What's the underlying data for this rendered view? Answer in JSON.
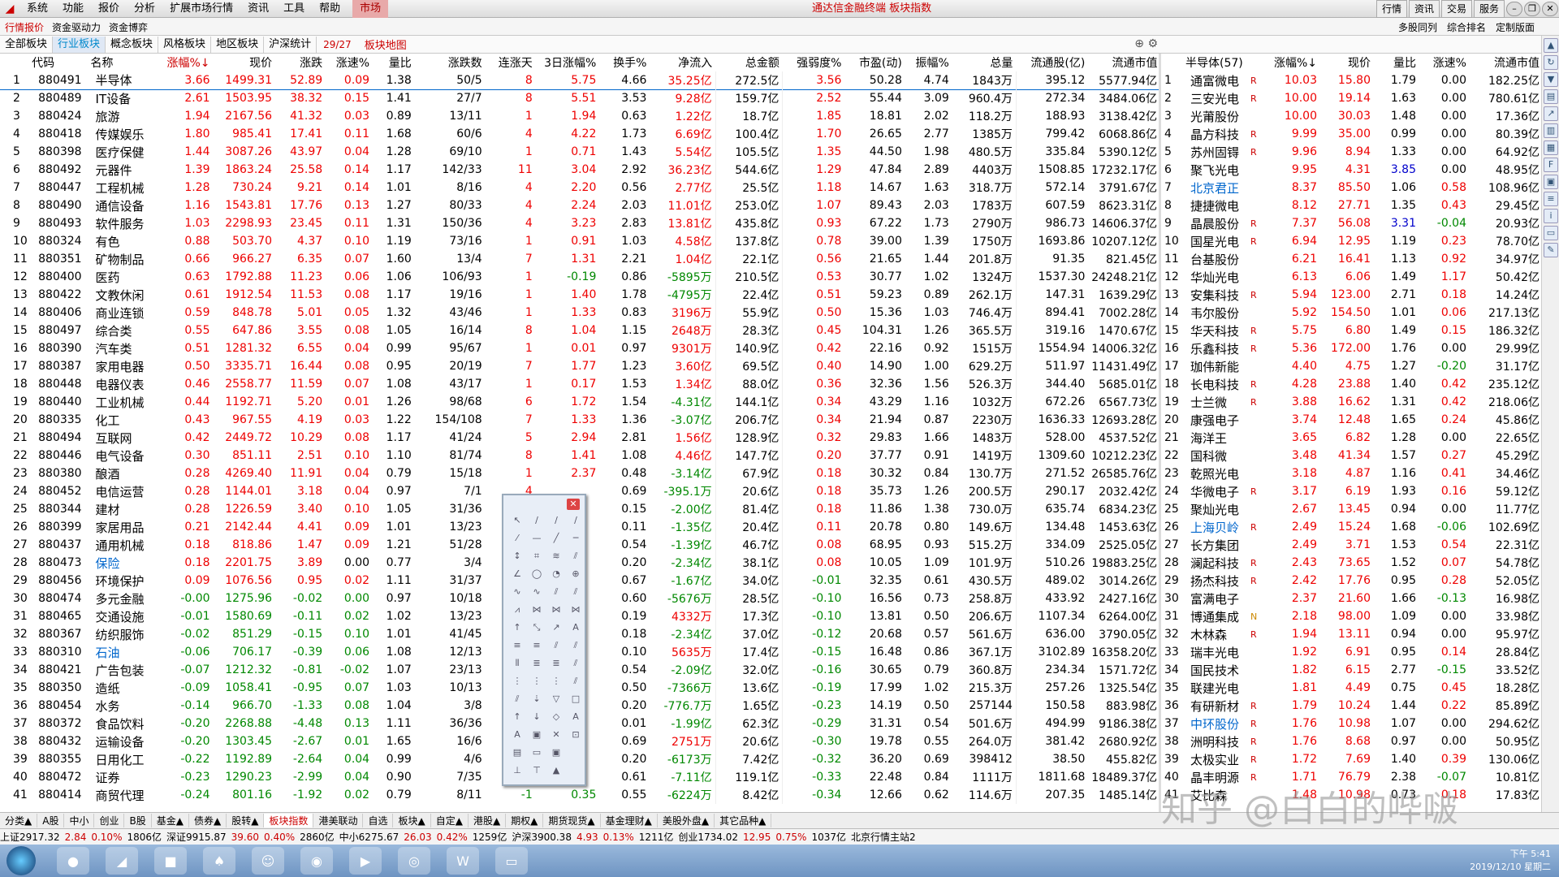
{
  "menu": {
    "items": [
      "系统",
      "功能",
      "报价",
      "分析",
      "扩展市场行情",
      "资讯",
      "工具",
      "帮助"
    ],
    "market": "市场",
    "title": "通达信金融终端 板块指数",
    "right": [
      "行情",
      "资讯",
      "交易",
      "服务"
    ]
  },
  "tabs2": {
    "left": "行情报价",
    "mid": "资金驱动力",
    "mid2": "资金博弈",
    "right": [
      "多股同列",
      "综合排名",
      "定制版面"
    ]
  },
  "tabs3": {
    "items": [
      "全部板块",
      "行业板块",
      "概念板块",
      "风格板块",
      "地区板块",
      "沪深统计"
    ],
    "page": "29/27",
    "map": "板块地图"
  },
  "main_headers": [
    "",
    "代码",
    "名称",
    "涨幅%↓",
    "现价",
    "涨跌",
    "涨速%",
    "量比",
    "涨跌数",
    "连涨天",
    "3日涨幅%",
    "换手%",
    "净流入",
    "总金额",
    "强弱度%",
    "市盈(动)",
    "振幅%",
    "总量",
    "流通股(亿)",
    "流通市值"
  ],
  "rows": [
    [
      "1",
      "880491",
      "半导体",
      "3.66",
      "1499.31",
      "52.89",
      "0.09",
      "1.38",
      "50/5",
      "8",
      "5.75",
      "4.66",
      "35.25亿",
      "272.5亿",
      "3.56",
      "50.28",
      "4.74",
      "1843万",
      "395.12",
      "5577.94亿"
    ],
    [
      "2",
      "880489",
      "IT设备",
      "2.61",
      "1503.95",
      "38.32",
      "0.15",
      "1.41",
      "27/7",
      "8",
      "5.51",
      "3.53",
      "9.28亿",
      "159.7亿",
      "2.52",
      "55.44",
      "3.09",
      "960.4万",
      "272.34",
      "3484.06亿"
    ],
    [
      "3",
      "880424",
      "旅游",
      "1.94",
      "2167.56",
      "41.32",
      "0.03",
      "0.89",
      "13/11",
      "1",
      "1.94",
      "0.63",
      "1.22亿",
      "18.7亿",
      "1.85",
      "18.81",
      "2.02",
      "118.2万",
      "188.93",
      "3138.42亿"
    ],
    [
      "4",
      "880418",
      "传媒娱乐",
      "1.80",
      "985.41",
      "17.41",
      "0.11",
      "1.68",
      "60/6",
      "4",
      "4.22",
      "1.73",
      "6.69亿",
      "100.4亿",
      "1.70",
      "26.65",
      "2.77",
      "1385万",
      "799.42",
      "6068.86亿"
    ],
    [
      "5",
      "880398",
      "医疗保健",
      "1.44",
      "3087.26",
      "43.97",
      "0.04",
      "1.28",
      "69/10",
      "1",
      "0.71",
      "1.43",
      "5.54亿",
      "105.5亿",
      "1.35",
      "44.50",
      "1.98",
      "480.5万",
      "335.84",
      "5390.12亿"
    ],
    [
      "6",
      "880492",
      "元器件",
      "1.39",
      "1863.24",
      "25.58",
      "0.14",
      "1.17",
      "142/33",
      "11",
      "3.04",
      "2.92",
      "36.23亿",
      "544.6亿",
      "1.29",
      "47.84",
      "2.89",
      "4403万",
      "1508.85",
      "17232.17亿"
    ],
    [
      "7",
      "880447",
      "工程机械",
      "1.28",
      "730.24",
      "9.21",
      "0.14",
      "1.01",
      "8/16",
      "4",
      "2.20",
      "0.56",
      "2.77亿",
      "25.5亿",
      "1.18",
      "14.67",
      "1.63",
      "318.7万",
      "572.14",
      "3791.67亿"
    ],
    [
      "8",
      "880490",
      "通信设备",
      "1.16",
      "1543.81",
      "17.76",
      "0.13",
      "1.27",
      "80/33",
      "4",
      "2.24",
      "2.03",
      "11.01亿",
      "253.0亿",
      "1.07",
      "89.43",
      "2.03",
      "1783万",
      "607.59",
      "8623.31亿"
    ],
    [
      "9",
      "880493",
      "软件服务",
      "1.03",
      "2298.93",
      "23.45",
      "0.11",
      "1.31",
      "150/36",
      "4",
      "3.23",
      "2.83",
      "13.81亿",
      "435.8亿",
      "0.93",
      "67.22",
      "1.73",
      "2790万",
      "986.73",
      "14606.37亿"
    ],
    [
      "10",
      "880324",
      "有色",
      "0.88",
      "503.70",
      "4.37",
      "0.10",
      "1.19",
      "73/16",
      "1",
      "0.91",
      "1.03",
      "4.58亿",
      "137.8亿",
      "0.78",
      "39.00",
      "1.39",
      "1750万",
      "1693.86",
      "10207.12亿"
    ],
    [
      "11",
      "880351",
      "矿物制品",
      "0.66",
      "966.27",
      "6.35",
      "0.07",
      "1.60",
      "13/4",
      "7",
      "1.31",
      "2.21",
      "1.04亿",
      "22.1亿",
      "0.56",
      "21.65",
      "1.44",
      "201.8万",
      "91.35",
      "821.45亿"
    ],
    [
      "12",
      "880400",
      "医药",
      "0.63",
      "1792.88",
      "11.23",
      "0.06",
      "1.06",
      "106/93",
      "1",
      "-0.19",
      "0.86",
      "-5895万",
      "210.5亿",
      "0.53",
      "30.77",
      "1.02",
      "1324万",
      "1537.30",
      "24248.21亿"
    ],
    [
      "13",
      "880422",
      "文教休闲",
      "0.61",
      "1912.54",
      "11.53",
      "0.08",
      "1.17",
      "19/16",
      "1",
      "1.40",
      "1.78",
      "-4795万",
      "22.4亿",
      "0.51",
      "59.23",
      "0.89",
      "262.1万",
      "147.31",
      "1639.29亿"
    ],
    [
      "14",
      "880406",
      "商业连锁",
      "0.59",
      "848.78",
      "5.01",
      "0.05",
      "1.32",
      "43/46",
      "1",
      "1.33",
      "0.83",
      "3196万",
      "55.9亿",
      "0.50",
      "15.36",
      "1.03",
      "746.4万",
      "894.41",
      "7002.28亿"
    ],
    [
      "15",
      "880497",
      "综合类",
      "0.55",
      "647.86",
      "3.55",
      "0.08",
      "1.05",
      "16/14",
      "8",
      "1.04",
      "1.15",
      "2648万",
      "28.3亿",
      "0.45",
      "104.31",
      "1.26",
      "365.5万",
      "319.16",
      "1470.67亿"
    ],
    [
      "16",
      "880390",
      "汽车类",
      "0.51",
      "1281.32",
      "6.55",
      "0.04",
      "0.99",
      "95/67",
      "1",
      "0.01",
      "0.97",
      "9301万",
      "140.9亿",
      "0.42",
      "22.16",
      "0.92",
      "1515万",
      "1554.94",
      "14006.32亿"
    ],
    [
      "17",
      "880387",
      "家用电器",
      "0.50",
      "3335.71",
      "16.44",
      "0.08",
      "0.95",
      "20/19",
      "7",
      "1.77",
      "1.23",
      "3.60亿",
      "69.5亿",
      "0.40",
      "14.90",
      "1.00",
      "629.2万",
      "511.97",
      "11431.49亿"
    ],
    [
      "18",
      "880448",
      "电器仪表",
      "0.46",
      "2558.77",
      "11.59",
      "0.07",
      "1.08",
      "43/17",
      "1",
      "0.17",
      "1.53",
      "1.34亿",
      "88.0亿",
      "0.36",
      "32.36",
      "1.56",
      "526.3万",
      "344.40",
      "5685.01亿"
    ],
    [
      "19",
      "880440",
      "工业机械",
      "0.44",
      "1192.71",
      "5.20",
      "0.01",
      "1.26",
      "98/68",
      "6",
      "1.72",
      "1.54",
      "-4.31亿",
      "144.1亿",
      "0.34",
      "43.29",
      "1.16",
      "1032万",
      "672.26",
      "6567.73亿"
    ],
    [
      "20",
      "880335",
      "化工",
      "0.43",
      "967.55",
      "4.19",
      "0.03",
      "1.22",
      "154/108",
      "7",
      "1.33",
      "1.36",
      "-3.07亿",
      "206.7亿",
      "0.34",
      "21.94",
      "0.87",
      "2230万",
      "1636.33",
      "12693.28亿"
    ],
    [
      "21",
      "880494",
      "互联网",
      "0.42",
      "2449.72",
      "10.29",
      "0.08",
      "1.17",
      "41/24",
      "5",
      "2.94",
      "2.81",
      "1.56亿",
      "128.9亿",
      "0.32",
      "29.83",
      "1.66",
      "1483万",
      "528.00",
      "4537.52亿"
    ],
    [
      "22",
      "880446",
      "电气设备",
      "0.30",
      "851.11",
      "2.51",
      "0.10",
      "1.10",
      "81/74",
      "8",
      "1.41",
      "1.08",
      "4.46亿",
      "147.7亿",
      "0.20",
      "37.77",
      "0.91",
      "1419万",
      "1309.60",
      "10212.23亿"
    ],
    [
      "23",
      "880380",
      "酿酒",
      "0.28",
      "4269.40",
      "11.91",
      "0.04",
      "0.79",
      "15/18",
      "1",
      "2.37",
      "0.48",
      "-3.14亿",
      "67.9亿",
      "0.18",
      "30.32",
      "0.84",
      "130.7万",
      "271.52",
      "26585.76亿"
    ],
    [
      "24",
      "880452",
      "电信运营",
      "0.28",
      "1144.01",
      "3.18",
      "0.04",
      "0.97",
      "7/1",
      "4",
      "",
      "0.69",
      "-395.1万",
      "20.6亿",
      "0.18",
      "35.73",
      "1.26",
      "200.5万",
      "290.17",
      "2032.42亿"
    ],
    [
      "25",
      "880344",
      "建材",
      "0.28",
      "1226.59",
      "3.40",
      "0.10",
      "1.05",
      "31/36",
      "4",
      "",
      "0.15",
      "-2.00亿",
      "81.4亿",
      "0.18",
      "11.86",
      "1.38",
      "730.0万",
      "635.74",
      "6834.23亿"
    ],
    [
      "26",
      "880399",
      "家居用品",
      "0.21",
      "2142.44",
      "4.41",
      "0.09",
      "1.01",
      "13/23",
      "4",
      "",
      "0.11",
      "-1.35亿",
      "20.4亿",
      "0.11",
      "20.78",
      "0.80",
      "149.6万",
      "134.48",
      "1453.63亿"
    ],
    [
      "27",
      "880437",
      "通用机械",
      "0.18",
      "818.86",
      "1.47",
      "0.09",
      "1.21",
      "51/28",
      "7",
      "",
      "0.54",
      "-1.39亿",
      "46.7亿",
      "0.08",
      "68.95",
      "0.93",
      "515.2万",
      "334.09",
      "2525.05亿"
    ],
    [
      "28",
      "880473",
      "保险",
      "0.18",
      "2201.75",
      "3.89",
      "0.00",
      "0.77",
      "3/4",
      "1",
      "",
      "0.20",
      "-2.34亿",
      "38.1亿",
      "0.08",
      "10.05",
      "1.09",
      "101.9万",
      "510.26",
      "19883.25亿"
    ],
    [
      "29",
      "880456",
      "环境保护",
      "0.09",
      "1076.56",
      "0.95",
      "0.02",
      "1.11",
      "31/37",
      "4",
      "",
      "0.67",
      "-1.67亿",
      "34.0亿",
      "-0.01",
      "32.35",
      "0.61",
      "430.5万",
      "489.02",
      "3014.26亿"
    ],
    [
      "30",
      "880474",
      "多元金融",
      "-0.00",
      "1275.96",
      "-0.02",
      "0.00",
      "0.97",
      "10/18",
      "-1",
      "",
      "0.60",
      "-5676万",
      "28.5亿",
      "-0.10",
      "16.56",
      "0.73",
      "258.8万",
      "433.92",
      "2427.16亿"
    ],
    [
      "31",
      "880465",
      "交通设施",
      "-0.01",
      "1580.69",
      "-0.11",
      "0.02",
      "1.02",
      "13/23",
      "-2",
      "",
      "0.19",
      "4332万",
      "17.3亿",
      "-0.10",
      "13.81",
      "0.50",
      "206.6万",
      "1107.34",
      "6264.00亿"
    ],
    [
      "32",
      "880367",
      "纺织服饰",
      "-0.02",
      "851.29",
      "-0.15",
      "0.10",
      "1.01",
      "41/45",
      "-2",
      "",
      "0.18",
      "-2.34亿",
      "37.0亿",
      "-0.12",
      "20.68",
      "0.57",
      "561.6万",
      "636.00",
      "3790.05亿"
    ],
    [
      "33",
      "880310",
      "石油",
      "-0.06",
      "706.17",
      "-0.39",
      "0.06",
      "1.08",
      "12/13",
      "-1",
      "",
      "0.10",
      "5635万",
      "17.4亿",
      "-0.15",
      "16.48",
      "0.86",
      "367.1万",
      "3102.89",
      "16358.20亿"
    ],
    [
      "34",
      "880421",
      "广告包装",
      "-0.07",
      "1212.32",
      "-0.81",
      "-0.02",
      "1.07",
      "23/13",
      "-1",
      "",
      "0.54",
      "-2.09亿",
      "32.0亿",
      "-0.16",
      "30.65",
      "0.79",
      "360.8万",
      "234.34",
      "1571.72亿"
    ],
    [
      "35",
      "880350",
      "造纸",
      "-0.09",
      "1058.41",
      "-0.95",
      "0.07",
      "1.03",
      "10/13",
      "-1",
      "",
      "0.50",
      "-7366万",
      "13.6亿",
      "-0.19",
      "17.99",
      "1.02",
      "215.3万",
      "257.26",
      "1325.54亿"
    ],
    [
      "36",
      "880454",
      "水务",
      "-0.14",
      "966.70",
      "-1.33",
      "0.08",
      "1.04",
      "3/8",
      "-1",
      "",
      "0.20",
      "-776.7万",
      "1.65亿",
      "-0.23",
      "14.19",
      "0.50",
      "257144",
      "150.58",
      "883.98亿"
    ],
    [
      "37",
      "880372",
      "食品饮料",
      "-0.20",
      "2268.88",
      "-4.48",
      "0.13",
      "1.11",
      "36/36",
      "-2",
      "",
      "0.01",
      "-1.99亿",
      "62.3亿",
      "-0.29",
      "31.31",
      "0.54",
      "501.6万",
      "494.99",
      "9186.38亿"
    ],
    [
      "38",
      "880432",
      "运输设备",
      "-0.20",
      "1303.45",
      "-2.67",
      "0.01",
      "1.65",
      "16/6",
      "-1",
      "",
      "0.69",
      "2751万",
      "20.6亿",
      "-0.30",
      "19.78",
      "0.55",
      "264.0万",
      "381.42",
      "2680.92亿"
    ],
    [
      "39",
      "880355",
      "日用化工",
      "-0.22",
      "1192.89",
      "-2.64",
      "0.04",
      "0.99",
      "4/6",
      "-2",
      "",
      "0.20",
      "-6173万",
      "7.42亿",
      "-0.32",
      "36.20",
      "0.69",
      "398412",
      "38.50",
      "455.82亿"
    ],
    [
      "40",
      "880472",
      "证券",
      "-0.23",
      "1290.23",
      "-2.99",
      "0.04",
      "0.90",
      "7/35",
      "-2",
      "",
      "0.61",
      "-7.11亿",
      "119.1亿",
      "-0.33",
      "22.48",
      "0.84",
      "1111万",
      "1811.68",
      "18489.37亿"
    ],
    [
      "41",
      "880414",
      "商贸代理",
      "-0.24",
      "801.16",
      "-1.92",
      "0.02",
      "0.79",
      "8/11",
      "-1",
      "0.35",
      "0.55",
      "-6224万",
      "8.42亿",
      "-0.34",
      "12.66",
      "0.62",
      "114.6万",
      "207.35",
      "1485.14亿"
    ]
  ],
  "side": {
    "title": "半导体(57)",
    "headers": [
      "",
      "半导体(57)",
      "",
      "涨幅%↓",
      "现价",
      "量比",
      "涨速%",
      "流通市值"
    ],
    "rows": [
      [
        "1",
        "通富微电",
        "R",
        "10.03",
        "15.80",
        "1.79",
        "0.00",
        "182.25亿"
      ],
      [
        "2",
        "三安光电",
        "R",
        "10.00",
        "19.14",
        "1.63",
        "0.00",
        "780.61亿"
      ],
      [
        "3",
        "光莆股份",
        "",
        "10.00",
        "30.03",
        "1.48",
        "0.00",
        "17.36亿"
      ],
      [
        "4",
        "晶方科技",
        "R",
        "9.99",
        "35.00",
        "0.99",
        "0.00",
        "80.39亿"
      ],
      [
        "5",
        "苏州固锝",
        "R",
        "9.96",
        "8.94",
        "1.33",
        "0.00",
        "64.92亿"
      ],
      [
        "6",
        "聚飞光电",
        "",
        "9.95",
        "4.31",
        "3.85",
        "0.00",
        "48.95亿"
      ],
      [
        "7",
        "北京君正",
        "",
        "8.37",
        "85.50",
        "1.06",
        "0.58",
        "108.96亿"
      ],
      [
        "8",
        "捷捷微电",
        "",
        "8.12",
        "27.71",
        "1.35",
        "0.43",
        "29.45亿"
      ],
      [
        "9",
        "晶晨股份",
        "R",
        "7.37",
        "56.08",
        "3.31",
        "-0.04",
        "20.93亿"
      ],
      [
        "10",
        "国星光电",
        "R",
        "6.94",
        "12.95",
        "1.19",
        "0.23",
        "78.70亿"
      ],
      [
        "11",
        "台基股份",
        "",
        "6.21",
        "16.41",
        "1.13",
        "0.92",
        "34.97亿"
      ],
      [
        "12",
        "华灿光电",
        "",
        "6.13",
        "6.06",
        "1.49",
        "1.17",
        "50.42亿"
      ],
      [
        "13",
        "安集科技",
        "R",
        "5.94",
        "123.00",
        "2.71",
        "0.18",
        "14.24亿"
      ],
      [
        "14",
        "韦尔股份",
        "",
        "5.92",
        "154.50",
        "1.01",
        "0.06",
        "217.13亿"
      ],
      [
        "15",
        "华天科技",
        "R",
        "5.75",
        "6.80",
        "1.49",
        "0.15",
        "186.32亿"
      ],
      [
        "16",
        "乐鑫科技",
        "R",
        "5.36",
        "172.00",
        "1.76",
        "0.00",
        "29.99亿"
      ],
      [
        "17",
        "珈伟新能",
        "",
        "4.40",
        "4.75",
        "1.27",
        "-0.20",
        "31.17亿"
      ],
      [
        "18",
        "长电科技",
        "R",
        "4.28",
        "23.88",
        "1.40",
        "0.42",
        "235.12亿"
      ],
      [
        "19",
        "士兰微",
        "R",
        "3.88",
        "16.62",
        "1.31",
        "0.42",
        "218.06亿"
      ],
      [
        "20",
        "康强电子",
        "",
        "3.74",
        "12.48",
        "1.65",
        "0.24",
        "45.86亿"
      ],
      [
        "21",
        "海洋王",
        "",
        "3.65",
        "6.82",
        "1.28",
        "0.00",
        "22.65亿"
      ],
      [
        "22",
        "国科微",
        "",
        "3.48",
        "41.34",
        "1.57",
        "0.27",
        "45.29亿"
      ],
      [
        "23",
        "乾照光电",
        "",
        "3.18",
        "4.87",
        "1.16",
        "0.41",
        "34.46亿"
      ],
      [
        "24",
        "华微电子",
        "R",
        "3.17",
        "6.19",
        "1.93",
        "0.16",
        "59.12亿"
      ],
      [
        "25",
        "聚灿光电",
        "",
        "2.67",
        "13.45",
        "0.94",
        "0.00",
        "11.77亿"
      ],
      [
        "26",
        "上海贝岭",
        "R",
        "2.49",
        "15.24",
        "1.68",
        "-0.06",
        "102.69亿"
      ],
      [
        "27",
        "长方集团",
        "",
        "2.49",
        "3.71",
        "1.53",
        "0.54",
        "22.31亿"
      ],
      [
        "28",
        "澜起科技",
        "R",
        "2.43",
        "73.65",
        "1.52",
        "0.07",
        "54.78亿"
      ],
      [
        "29",
        "扬杰科技",
        "R",
        "2.42",
        "17.76",
        "0.95",
        "0.28",
        "52.05亿"
      ],
      [
        "30",
        "富满电子",
        "",
        "2.37",
        "21.60",
        "1.66",
        "-0.13",
        "16.98亿"
      ],
      [
        "31",
        "博通集成",
        "N",
        "2.18",
        "98.00",
        "1.09",
        "0.00",
        "33.98亿"
      ],
      [
        "32",
        "木林森",
        "R",
        "1.94",
        "13.11",
        "0.94",
        "0.00",
        "95.97亿"
      ],
      [
        "33",
        "瑞丰光电",
        "",
        "1.92",
        "6.91",
        "0.95",
        "0.14",
        "28.84亿"
      ],
      [
        "34",
        "国民技术",
        "",
        "1.82",
        "6.15",
        "2.77",
        "-0.15",
        "33.52亿"
      ],
      [
        "35",
        "联建光电",
        "",
        "1.81",
        "4.49",
        "0.75",
        "0.45",
        "18.28亿"
      ],
      [
        "36",
        "有研新材",
        "R",
        "1.79",
        "10.24",
        "1.44",
        "0.22",
        "85.89亿"
      ],
      [
        "37",
        "中环股份",
        "R",
        "1.76",
        "10.98",
        "1.07",
        "0.00",
        "294.62亿"
      ],
      [
        "38",
        "洲明科技",
        "R",
        "1.76",
        "8.68",
        "0.97",
        "0.00",
        "50.95亿"
      ],
      [
        "39",
        "太极实业",
        "R",
        "1.72",
        "7.69",
        "1.40",
        "0.39",
        "130.06亿"
      ],
      [
        "40",
        "晶丰明源",
        "R",
        "1.71",
        "76.79",
        "2.38",
        "-0.07",
        "10.81亿"
      ],
      [
        "41",
        "艾比森",
        "",
        "1.48",
        "10.98",
        "0.73",
        "0.18",
        "17.83亿"
      ]
    ]
  },
  "bottom_tabs": [
    "分类▲",
    "A股",
    "中小",
    "创业",
    "B股",
    "基金▲",
    "债券▲",
    "股转▲",
    "板块指数",
    "港美联动",
    "自选",
    "板块▲",
    "自定▲",
    "港股▲",
    "期权▲",
    "期货现货▲",
    "基金理财▲",
    "美股外盘▲",
    "其它品种▲"
  ],
  "status": [
    "上证2917.32",
    "2.84",
    "0.10%",
    "1806亿",
    "深证9915.87",
    "39.60",
    "0.40%",
    "2860亿",
    "中小6275.67",
    "26.03",
    "0.42%",
    "1259亿",
    "沪深3900.38",
    "4.93",
    "0.13%",
    "1211亿",
    "创业1734.02",
    "12.95",
    "0.75%",
    "1037亿",
    "北京行情主站2"
  ],
  "clock": {
    "time": "下午 5:41",
    "date": "2019/12/10 星期二"
  },
  "palette": {
    "close": "✕"
  },
  "watermark": "知乎 @白白的哔啵"
}
